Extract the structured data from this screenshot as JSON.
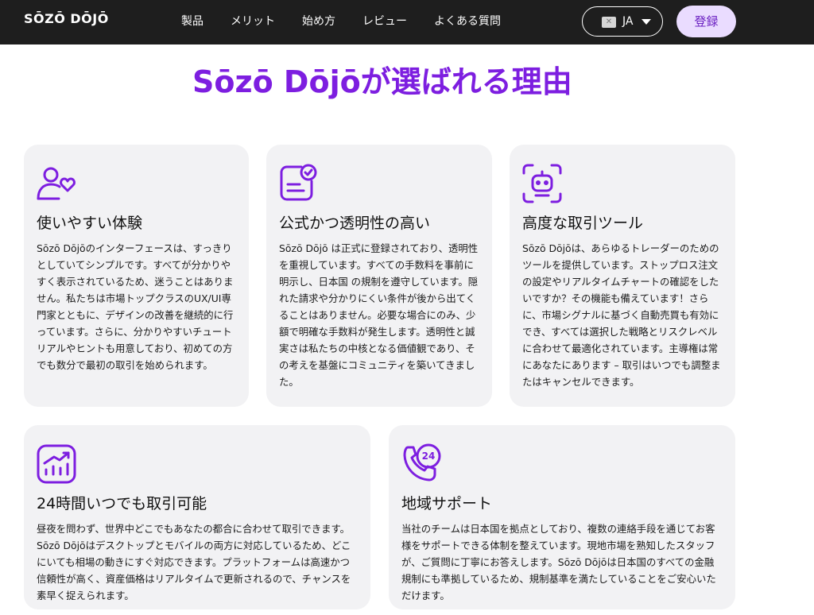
{
  "header": {
    "logo": "SŌZŌ DŌJŌ",
    "nav": [
      "製品",
      "メリット",
      "始め方",
      "レビュー",
      "よくある質問"
    ],
    "language": {
      "code": "JA",
      "flag": "✕"
    },
    "register_label": "登録"
  },
  "title": "Sōzō Dōjōが選ばれる理由",
  "colors": {
    "accent": "#7d1ee0",
    "header_bg": "#1e1e1e",
    "card_bg": "#f2f2f4",
    "button_bg": "#eadcff"
  },
  "features": [
    {
      "icon": "user-heart-icon",
      "heading": "使いやすい体験",
      "body": "Sōzō Dōjōのインターフェースは、すっきりとしていてシンプルです。すべてが分かりやすく表示されているため、迷うことはありません。私たちは市場トップクラスのUX/UI専門家とともに、デザインの改善を継続的に行っています。さらに、分かりやすいチュートリアルやヒントも用意しており、初めての方でも数分で最初の取引を始められます。"
    },
    {
      "icon": "document-check-icon",
      "heading": "公式かつ透明性の高い",
      "body": "Sōzō Dōjō は正式に登録されており、透明性を重視しています。すべての手数料を事前に明示し、日本国 の規制を遵守しています。隠れた請求や分かりにくい条件が後から出てくることはありません。必要な場合にのみ、少額で明確な手数料が発生します。透明性と誠実さは私たちの中核となる価値観であり、その考えを基盤にコミュニティを築いてきました。"
    },
    {
      "icon": "robot-scan-icon",
      "heading": "高度な取引ツール",
      "body": "Sōzō Dōjōは、あらゆるトレーダーのためのツールを提供しています。ストップロス注文の設定やリアルタイムチャートの確認をしたいですか？その機能も備えています！さらに、市場シグナルに基づく自動売買も有効にでき、すべては選択した戦略とリスクレベルに合わせて最適化されています。主導権は常にあなたにあります – 取引はいつでも調整またはキャンセルできます。"
    },
    {
      "icon": "chart-growth-icon",
      "heading": "24時間いつでも取引可能",
      "body": "昼夜を問わず、世界中どこでもあなたの都合に合わせて取引できます。Sōzō Dōjōはデスクトップとモバイルの両方に対応しているため、どこにいても相場の動きにすぐ対応できます。プラットフォームは高速かつ信頼性が高く、資産価格はリアルタイムで更新されるので、チャンスを素早く捉えられます。"
    },
    {
      "icon": "phone-24-icon",
      "heading": "地域サポート",
      "body": "当社のチームは日本国を拠点としており、複数の連絡手段を通じてお客様をサポートできる体制を整えています。現地市場を熟知したスタッフが、ご質問に丁寧にお答えします。Sōzō Dōjōは日本国のすべての金融規制にも準拠しているため、規制基準を満たしていることをご安心いただけます。"
    }
  ]
}
